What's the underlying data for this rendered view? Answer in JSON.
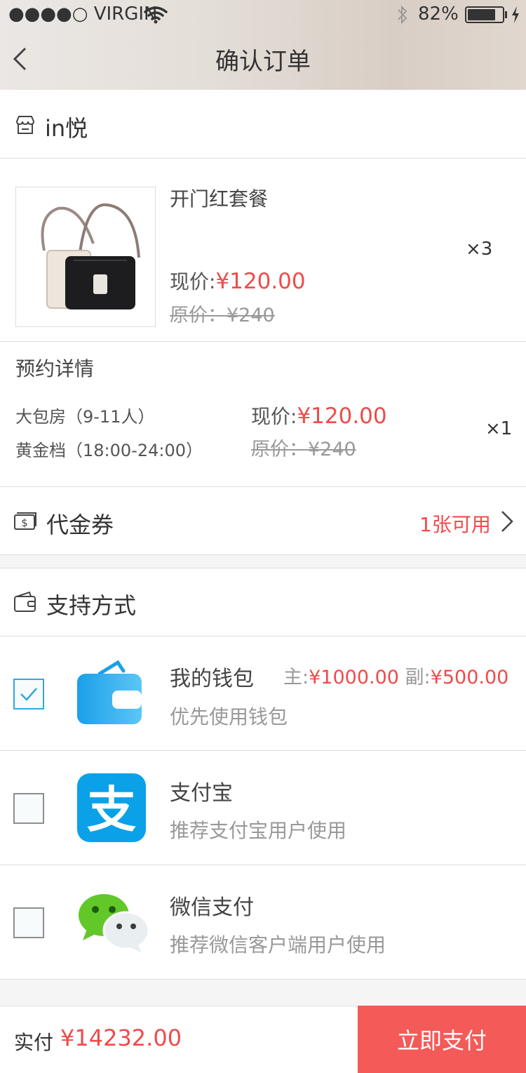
{
  "status_bar": {
    "carrier": "●●●●○ VIRGIN",
    "battery": "82%"
  },
  "nav": {
    "title": "确认订单"
  },
  "shop": {
    "name": "in悦"
  },
  "product": {
    "name": "开门红套餐",
    "price_label": "现价:",
    "price": "¥120.00",
    "original": "原价：¥240",
    "quantity": "×3"
  },
  "booking": {
    "title": "预约详情",
    "room": "大包房（9-11人）",
    "slot": "黄金档（18:00-24:00）",
    "price_label": "现价:",
    "price": "¥120.00",
    "original": "原价：¥240",
    "quantity": "×1"
  },
  "voucher": {
    "label": "代金券",
    "available": "1张可用"
  },
  "payment": {
    "section_title": "支持方式",
    "methods": [
      {
        "name": "我的钱包",
        "desc": "优先使用钱包",
        "main_label": "主:",
        "main_value": "¥1000.00",
        "sub_label": "副:",
        "sub_value": "¥500.00",
        "checked": true
      },
      {
        "name": "支付宝",
        "desc": "推荐支付宝用户使用",
        "checked": false
      },
      {
        "name": "微信支付",
        "desc": "推荐微信客户端用户使用",
        "checked": false
      }
    ]
  },
  "footer": {
    "total_label": "实付",
    "total": "¥14232.00",
    "pay_button": "立即支付"
  },
  "colors": {
    "accent_red": "#f14a4a",
    "pay_button": "#f45a58",
    "checkbox_checked": "#35a6dd"
  }
}
